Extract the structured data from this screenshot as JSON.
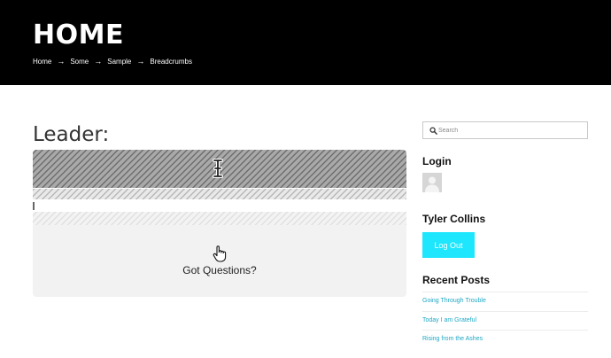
{
  "header": {
    "title": "HOME",
    "breadcrumbs": [
      "Home",
      "Some",
      "Sample",
      "Breadcrumbs"
    ],
    "separator": "→"
  },
  "main": {
    "section_title": "Leader:",
    "questions_label": "Got Questions?"
  },
  "sidebar": {
    "search_placeholder": "Search",
    "login_heading": "Login",
    "user_name": "Tyler Collins",
    "logout_label": "Log Out",
    "recent_heading": "Recent Posts",
    "posts": [
      "Going Through Trouble",
      "Today I am Grateful",
      "Rising from the Ashes"
    ]
  },
  "colors": {
    "header_bg": "#000000",
    "button_accent": "#1de6fd",
    "link": "#1fa8c4"
  },
  "icons": [
    "search-icon",
    "avatar-placeholder-icon",
    "text-cursor-icon",
    "hand-pointer-icon"
  ]
}
